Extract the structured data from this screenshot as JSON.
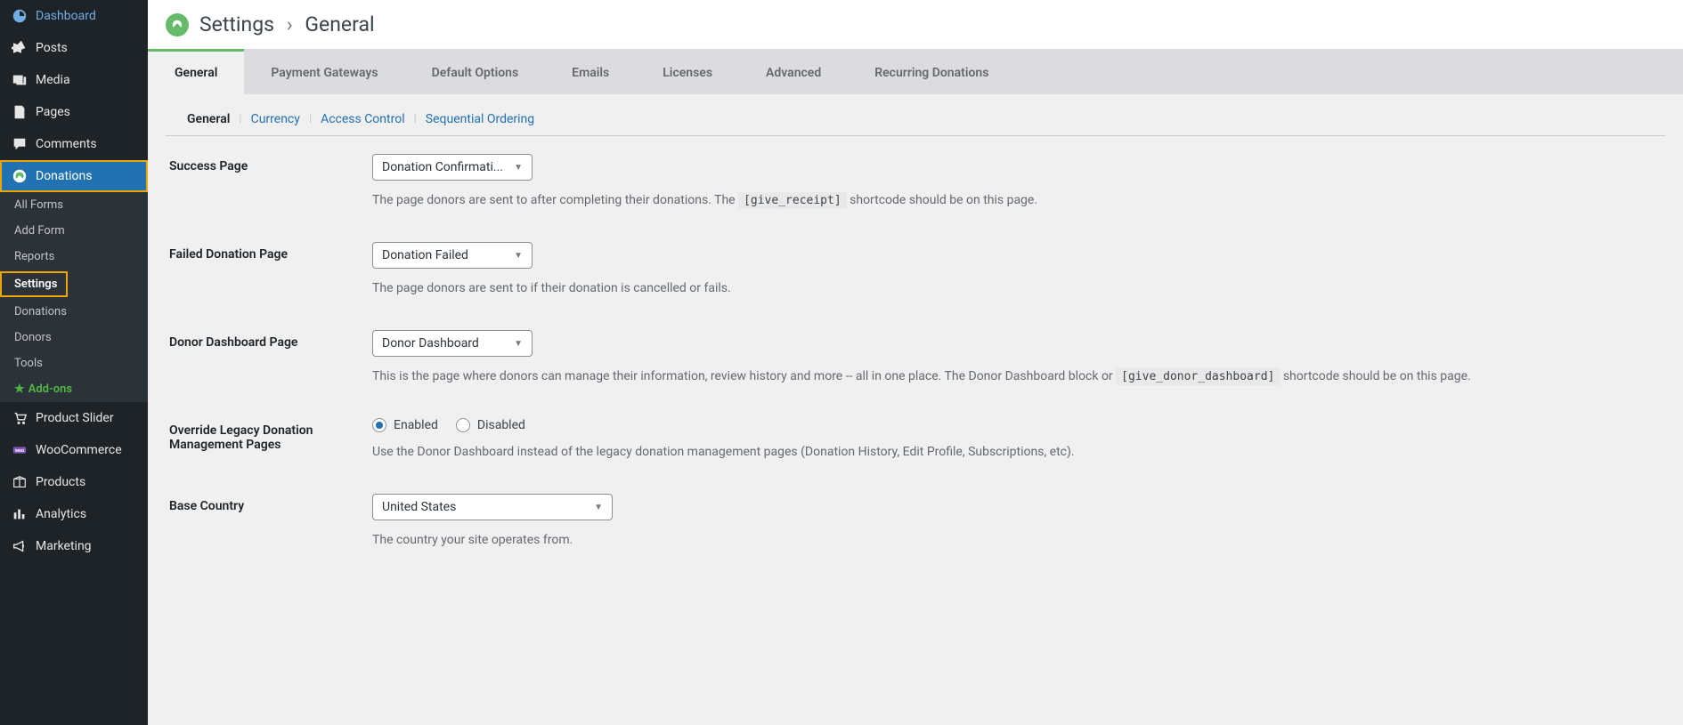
{
  "sidebar": {
    "main_items": [
      {
        "label": "Dashboard",
        "icon": "dashboard"
      },
      {
        "label": "Posts",
        "icon": "pin"
      },
      {
        "label": "Media",
        "icon": "media"
      },
      {
        "label": "Pages",
        "icon": "pages"
      },
      {
        "label": "Comments",
        "icon": "comment"
      },
      {
        "label": "Donations",
        "icon": "give",
        "active": true,
        "highlighted": true
      },
      {
        "label": "Product Slider",
        "icon": "cart"
      },
      {
        "label": "WooCommerce",
        "icon": "woo"
      },
      {
        "label": "Products",
        "icon": "box"
      },
      {
        "label": "Analytics",
        "icon": "analytics"
      },
      {
        "label": "Marketing",
        "icon": "megaphone"
      }
    ],
    "submenu": [
      {
        "label": "All Forms"
      },
      {
        "label": "Add Form"
      },
      {
        "label": "Reports"
      },
      {
        "label": "Settings",
        "highlighted": true,
        "current": true
      },
      {
        "label": "Donations"
      },
      {
        "label": "Donors"
      },
      {
        "label": "Tools"
      },
      {
        "label": "Add-ons",
        "addons": true
      }
    ]
  },
  "header": {
    "title_part1": "Settings",
    "separator": "›",
    "title_part2": "General"
  },
  "tabs_primary": [
    {
      "label": "General",
      "active": true
    },
    {
      "label": "Payment Gateways"
    },
    {
      "label": "Default Options"
    },
    {
      "label": "Emails"
    },
    {
      "label": "Licenses"
    },
    {
      "label": "Advanced"
    },
    {
      "label": "Recurring Donations"
    }
  ],
  "tabs_secondary": [
    {
      "label": "General",
      "active": true
    },
    {
      "label": "Currency"
    },
    {
      "label": "Access Control"
    },
    {
      "label": "Sequential Ordering"
    }
  ],
  "settings": {
    "success_page": {
      "label": "Success Page",
      "value": "Donation Confirmati...",
      "help_before": "The page donors are sent to after completing their donations. The ",
      "help_code": "[give_receipt]",
      "help_after": " shortcode should be on this page."
    },
    "failed_page": {
      "label": "Failed Donation Page",
      "value": "Donation Failed",
      "help": "The page donors are sent to if their donation is cancelled or fails."
    },
    "donor_dashboard": {
      "label": "Donor Dashboard Page",
      "value": "Donor Dashboard",
      "help_before": "This is the page where donors can manage their information, review history and more -- all in one place. The Donor Dashboard block or ",
      "help_code": "[give_donor_dashboard]",
      "help_after": " shortcode should be on this page."
    },
    "override_legacy": {
      "label": "Override Legacy Donation Management Pages",
      "option_enabled": "Enabled",
      "option_disabled": "Disabled",
      "help": "Use the Donor Dashboard instead of the legacy donation management pages (Donation History, Edit Profile, Subscriptions, etc)."
    },
    "base_country": {
      "label": "Base Country",
      "value": "United States",
      "help": "The country your site operates from."
    }
  }
}
